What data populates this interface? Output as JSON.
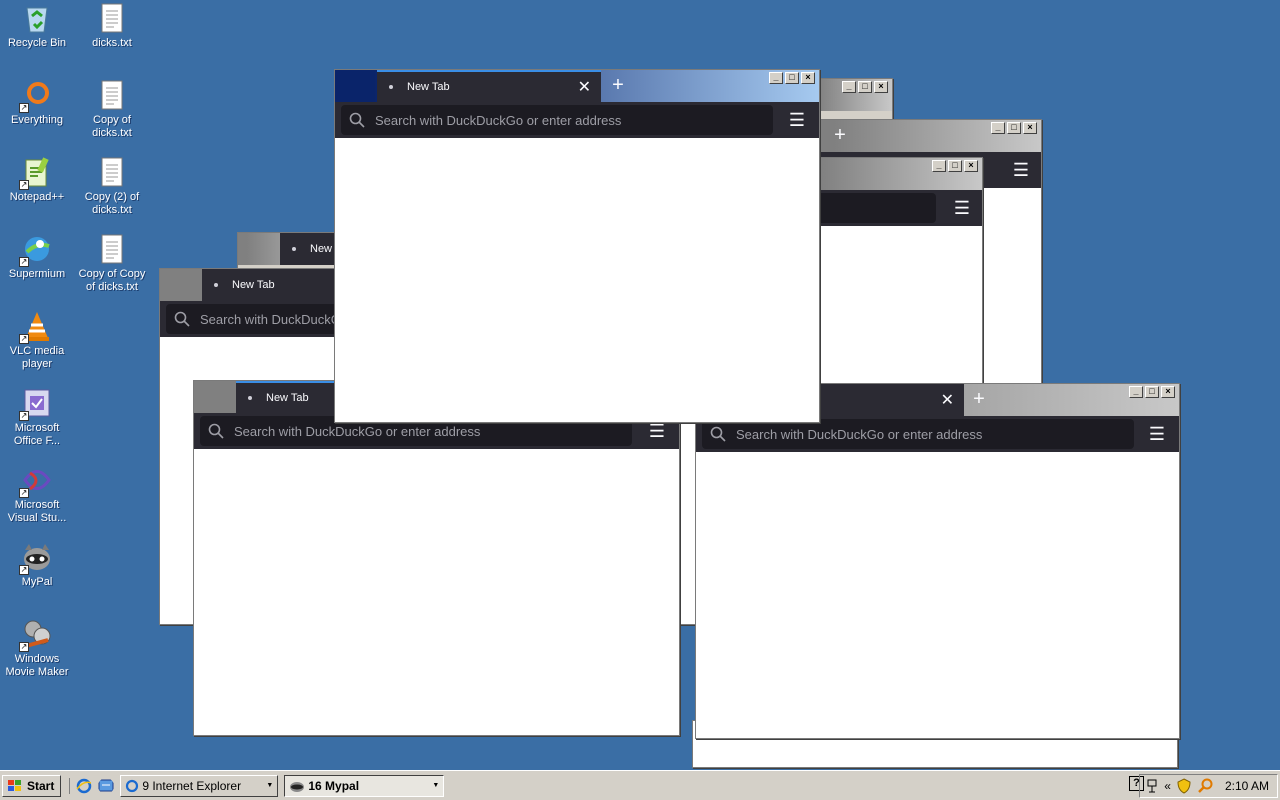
{
  "desktop": {
    "icons": [
      {
        "label": "Recycle Bin"
      },
      {
        "label": "dicks.txt"
      },
      {
        "label": "Everything"
      },
      {
        "label": "Copy of dicks.txt"
      },
      {
        "label": "Notepad++"
      },
      {
        "label": "Copy (2) of dicks.txt"
      },
      {
        "label": "Supermium"
      },
      {
        "label": "Copy of Copy of dicks.txt"
      },
      {
        "label": "VLC media player"
      },
      {
        "label": "Microsoft Office F..."
      },
      {
        "label": "Microsoft Visual Stu..."
      },
      {
        "label": "MyPal"
      },
      {
        "label": "Windows Movie Maker"
      }
    ]
  },
  "browser": {
    "tab_title": "New Tab",
    "tab_title_truncated": "New",
    "search_placeholder": "Search with DuckDuckGo or enter address",
    "search_placeholder_truncated": "Search with DuckDuckG",
    "menu_glyph": "☰",
    "newtab_glyph": "+",
    "close_glyph": "✕"
  },
  "taskbar": {
    "start_label": "Start",
    "groups": [
      {
        "label": "9 Internet Explorer"
      },
      {
        "label": "16 Mypal"
      }
    ],
    "clock": "2:10 AM",
    "tray_chevron": "«"
  },
  "colors": {
    "desktop": "#3a6ea5",
    "titlebar_active": "#0a246a",
    "browser_chrome": "#2b2a33",
    "url_field": "#1c1b22"
  }
}
